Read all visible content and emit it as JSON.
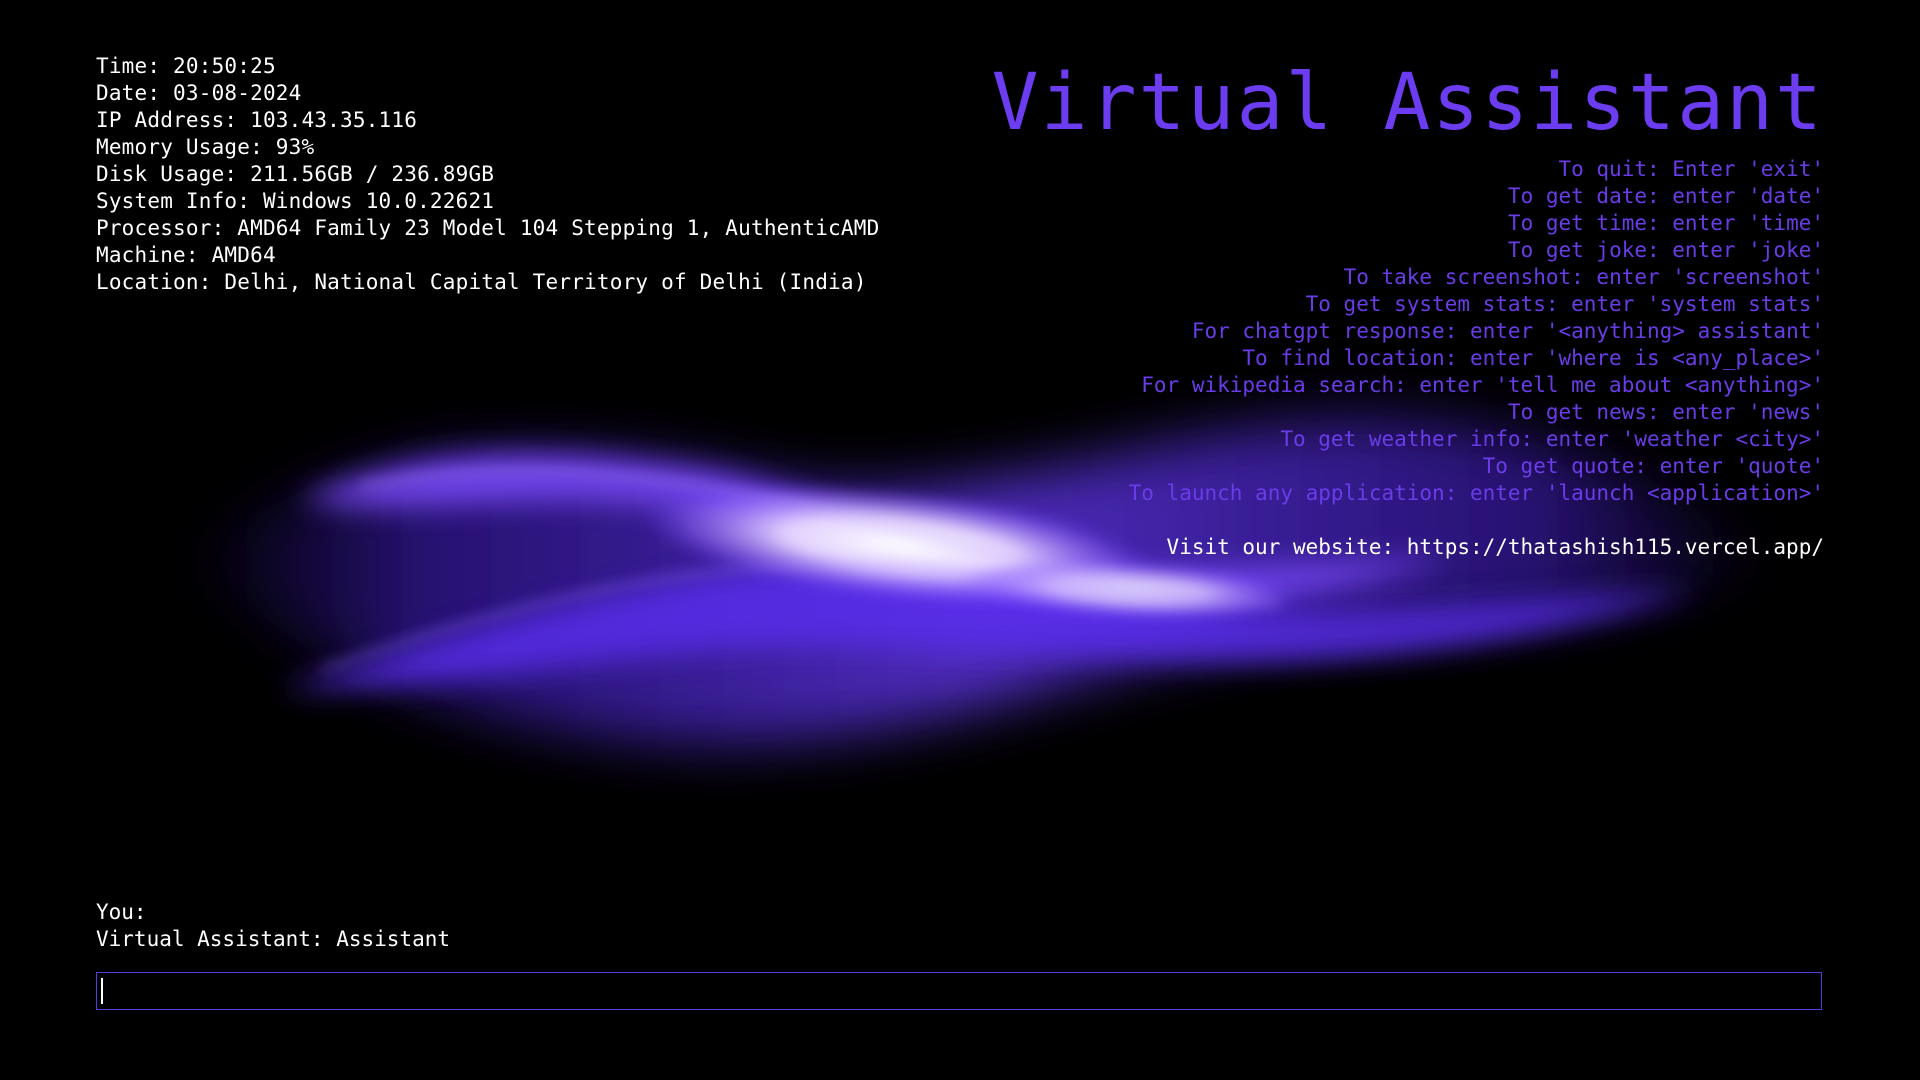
{
  "system_info": {
    "time": "Time: 20:50:25",
    "date": "Date: 03-08-2024",
    "ip": "IP Address: 103.43.35.116",
    "memory": "Memory Usage: 93%",
    "disk": "Disk Usage: 211.56GB / 236.89GB",
    "system": "System Info: Windows 10.0.22621",
    "processor": "Processor: AMD64 Family 23 Model 104 Stepping 1, AuthenticAMD",
    "machine": "Machine: AMD64",
    "location": "Location: Delhi, National Capital Territory of Delhi (India)"
  },
  "header": {
    "title": "Virtual Assistant"
  },
  "commands": [
    "To quit: Enter 'exit'",
    "To get date: enter 'date'",
    "To get time: enter 'time'",
    "To get joke: enter 'joke'",
    "To take screenshot: enter 'screenshot'",
    "To get system stats: enter 'system stats'",
    "For chatgpt response: enter '<anything> assistant'",
    "To find location: enter 'where is <any_place>'",
    "For wikipedia search: enter 'tell me about <anything>'",
    "To get news: enter 'news'",
    "To get weather info: enter 'weather <city>'",
    "To get quote: enter 'quote'",
    "To launch any application: enter 'launch <application>'"
  ],
  "website": "Visit our website: https://thatashish115.vercel.app/",
  "chat": {
    "you_line": "You:",
    "assistant_line": "Virtual Assistant: Assistant"
  },
  "input": {
    "value": "",
    "placeholder": ""
  },
  "colors": {
    "background": "#000000",
    "accent": "#6b3cf0",
    "text": "#ffffff",
    "wave_core": "#ffffff",
    "wave_glow": "#5a2df0"
  }
}
